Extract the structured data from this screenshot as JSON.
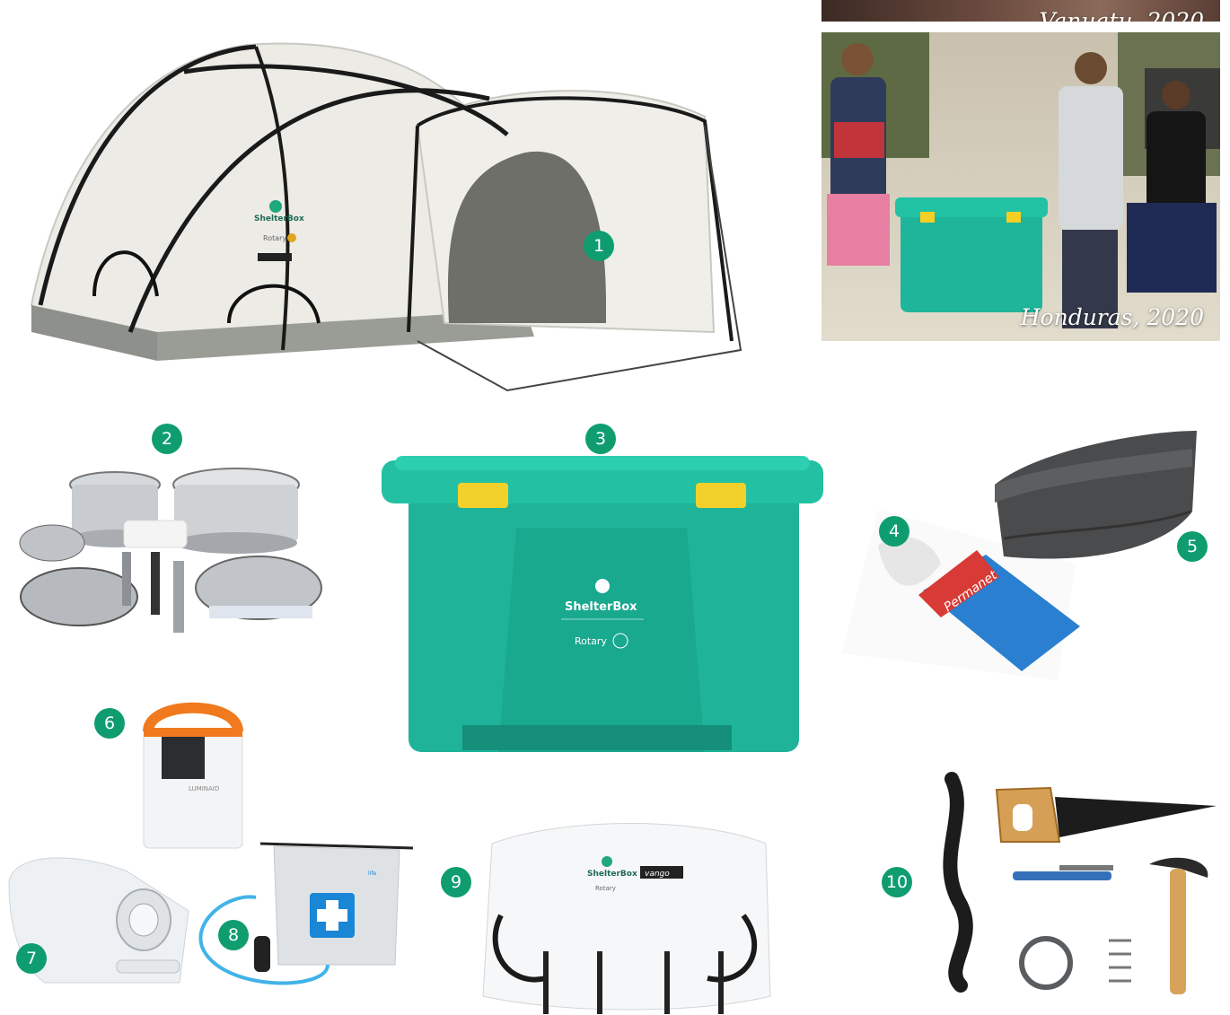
{
  "accent_color": "#0f9d6f",
  "photos": [
    {
      "caption": "Vanuatu, 2020"
    },
    {
      "caption": "Honduras, 2020"
    }
  ],
  "items": [
    {
      "number": "1",
      "icon": "tent-icon"
    },
    {
      "number": "2",
      "icon": "cookware-icon"
    },
    {
      "number": "3",
      "icon": "storage-box-icon"
    },
    {
      "number": "4",
      "icon": "mosquito-net-icon"
    },
    {
      "number": "5",
      "icon": "blanket-icon"
    },
    {
      "number": "6",
      "icon": "solar-lantern-icon"
    },
    {
      "number": "7",
      "icon": "water-carrier-icon"
    },
    {
      "number": "8",
      "icon": "water-filter-icon"
    },
    {
      "number": "9",
      "icon": "duffel-bag-icon"
    },
    {
      "number": "10",
      "icon": "tool-kit-icon"
    }
  ],
  "brand": {
    "box_logo": "ShelterBox",
    "rotary": "Rotary",
    "vango": "vango"
  }
}
